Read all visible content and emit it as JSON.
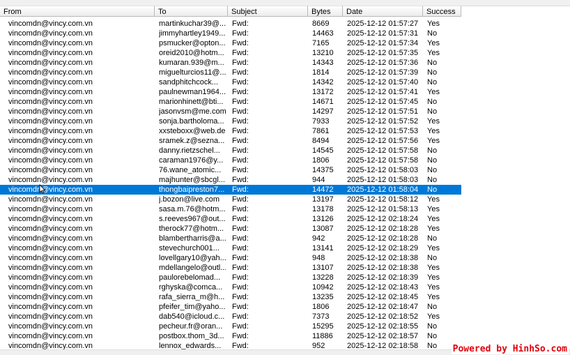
{
  "columns": {
    "from": "From",
    "to": "To",
    "subject": "Subject",
    "bytes": "Bytes",
    "date": "Date",
    "success": "Success"
  },
  "selected_index": 17,
  "rows": [
    {
      "from": "vincomdn@vincy.com.vn",
      "to": "martinkuchar39@...",
      "subject": "Fwd:",
      "bytes": "8669",
      "date": "2025-12-12 01:57:27",
      "success": "Yes"
    },
    {
      "from": "vincomdn@vincy.com.vn",
      "to": "jimmyhartley1949...",
      "subject": "Fwd:",
      "bytes": "14463",
      "date": "2025-12-12 01:57:31",
      "success": "No"
    },
    {
      "from": "vincomdn@vincy.com.vn",
      "to": "psmucker@opton...",
      "subject": "Fwd:",
      "bytes": "7165",
      "date": "2025-12-12 01:57:34",
      "success": "Yes"
    },
    {
      "from": "vincomdn@vincy.com.vn",
      "to": "oreid2010@hotm...",
      "subject": "Fwd:",
      "bytes": "13210",
      "date": "2025-12-12 01:57:35",
      "success": "Yes"
    },
    {
      "from": "vincomdn@vincy.com.vn",
      "to": "kumaran.939@m...",
      "subject": "Fwd:",
      "bytes": "14343",
      "date": "2025-12-12 01:57:36",
      "success": "No"
    },
    {
      "from": "vincomdn@vincy.com.vn",
      "to": "miguelturcios11@...",
      "subject": "Fwd:",
      "bytes": "1814",
      "date": "2025-12-12 01:57:39",
      "success": "No"
    },
    {
      "from": "vincomdn@vincy.com.vn",
      "to": "sandphitchcock...",
      "subject": "Fwd:",
      "bytes": "14342",
      "date": "2025-12-12 01:57:40",
      "success": "No"
    },
    {
      "from": "vincomdn@vincy.com.vn",
      "to": "paulnewman1964...",
      "subject": "Fwd:",
      "bytes": "13172",
      "date": "2025-12-12 01:57:41",
      "success": "Yes"
    },
    {
      "from": "vincomdn@vincy.com.vn",
      "to": "marionhinett@bti...",
      "subject": "Fwd:",
      "bytes": "14671",
      "date": "2025-12-12 01:57:45",
      "success": "No"
    },
    {
      "from": "vincomdn@vincy.com.vn",
      "to": "jasonvsm@me.com",
      "subject": "Fwd:",
      "bytes": "14297",
      "date": "2025-12-12 01:57:51",
      "success": "No"
    },
    {
      "from": "vincomdn@vincy.com.vn",
      "to": "sonja.bartholoma...",
      "subject": "Fwd:",
      "bytes": "7933",
      "date": "2025-12-12 01:57:52",
      "success": "Yes"
    },
    {
      "from": "vincomdn@vincy.com.vn",
      "to": "xxsteboxx@web.de",
      "subject": "Fwd:",
      "bytes": "7861",
      "date": "2025-12-12 01:57:53",
      "success": "Yes"
    },
    {
      "from": "vincomdn@vincy.com.vn",
      "to": "sramek.z@sezna...",
      "subject": "Fwd:",
      "bytes": "8494",
      "date": "2025-12-12 01:57:56",
      "success": "Yes"
    },
    {
      "from": "vincomdn@vincy.com.vn",
      "to": "danny.rietzschel...",
      "subject": "Fwd:",
      "bytes": "14545",
      "date": "2025-12-12 01:57:58",
      "success": "No"
    },
    {
      "from": "vincomdn@vincy.com.vn",
      "to": "caraman1976@y...",
      "subject": "Fwd:",
      "bytes": "1806",
      "date": "2025-12-12 01:57:58",
      "success": "No"
    },
    {
      "from": "vincomdn@vincy.com.vn",
      "to": "76.wane_atomic...",
      "subject": "Fwd:",
      "bytes": "14375",
      "date": "2025-12-12 01:58:03",
      "success": "No"
    },
    {
      "from": "vincomdn@vincy.com.vn",
      "to": "majhunter@sbcgl...",
      "subject": "Fwd:",
      "bytes": "944",
      "date": "2025-12-12 01:58:03",
      "success": "No"
    },
    {
      "from": "vincomdn@vincy.com.vn",
      "to": "thongbaipreston7...",
      "subject": "Fwd:",
      "bytes": "14472",
      "date": "2025-12-12 01:58:04",
      "success": "No"
    },
    {
      "from": "vincomdn@vincy.com.vn",
      "to": "j.bozon@live.com",
      "subject": "Fwd:",
      "bytes": "13197",
      "date": "2025-12-12 01:58:12",
      "success": "Yes"
    },
    {
      "from": "vincomdn@vincy.com.vn",
      "to": "sasa.m.76@hotm...",
      "subject": "Fwd:",
      "bytes": "13178",
      "date": "2025-12-12 01:58:13",
      "success": "Yes"
    },
    {
      "from": "vincomdn@vincy.com.vn",
      "to": "s.reeves967@out...",
      "subject": "Fwd:",
      "bytes": "13126",
      "date": "2025-12-12 02:18:24",
      "success": "Yes"
    },
    {
      "from": "vincomdn@vincy.com.vn",
      "to": "therock77@hotm...",
      "subject": "Fwd:",
      "bytes": "13087",
      "date": "2025-12-12 02:18:28",
      "success": "Yes"
    },
    {
      "from": "vincomdn@vincy.com.vn",
      "to": "blambertharris@a...",
      "subject": "Fwd:",
      "bytes": "942",
      "date": "2025-12-12 02:18:28",
      "success": "No"
    },
    {
      "from": "vincomdn@vincy.com.vn",
      "to": "stevechurch001...",
      "subject": "Fwd:",
      "bytes": "13141",
      "date": "2025-12-12 02:18:29",
      "success": "Yes"
    },
    {
      "from": "vincomdn@vincy.com.vn",
      "to": "lovellgary10@yah...",
      "subject": "Fwd:",
      "bytes": "948",
      "date": "2025-12-12 02:18:38",
      "success": "No"
    },
    {
      "from": "vincomdn@vincy.com.vn",
      "to": "mdellangelo@outl...",
      "subject": "Fwd:",
      "bytes": "13107",
      "date": "2025-12-12 02:18:38",
      "success": "Yes"
    },
    {
      "from": "vincomdn@vincy.com.vn",
      "to": "paulorebelomad...",
      "subject": "Fwd:",
      "bytes": "13228",
      "date": "2025-12-12 02:18:39",
      "success": "Yes"
    },
    {
      "from": "vincomdn@vincy.com.vn",
      "to": "rghyska@comca...",
      "subject": "Fwd:",
      "bytes": "10942",
      "date": "2025-12-12 02:18:43",
      "success": "Yes"
    },
    {
      "from": "vincomdn@vincy.com.vn",
      "to": "rafa_sierra_m@h...",
      "subject": "Fwd:",
      "bytes": "13235",
      "date": "2025-12-12 02:18:45",
      "success": "Yes"
    },
    {
      "from": "vincomdn@vincy.com.vn",
      "to": "pfeifer_tim@yaho...",
      "subject": "Fwd:",
      "bytes": "1806",
      "date": "2025-12-12 02:18:47",
      "success": "No"
    },
    {
      "from": "vincomdn@vincy.com.vn",
      "to": "dab540@icloud.c...",
      "subject": "Fwd:",
      "bytes": "7373",
      "date": "2025-12-12 02:18:52",
      "success": "Yes"
    },
    {
      "from": "vincomdn@vincy.com.vn",
      "to": "pecheur.fr@oran...",
      "subject": "Fwd:",
      "bytes": "15295",
      "date": "2025-12-12 02:18:55",
      "success": "No"
    },
    {
      "from": "vincomdn@vincy.com.vn",
      "to": "postbox.thom_3d...",
      "subject": "Fwd:",
      "bytes": "11886",
      "date": "2025-12-12 02:18:57",
      "success": "No"
    },
    {
      "from": "vincomdn@vincy.com.vn",
      "to": "lennox_edwards...",
      "subject": "Fwd:",
      "bytes": "952",
      "date": "2025-12-12 02:18:58",
      "success": "No"
    }
  ],
  "watermark": "Powered by HinhSo.com"
}
